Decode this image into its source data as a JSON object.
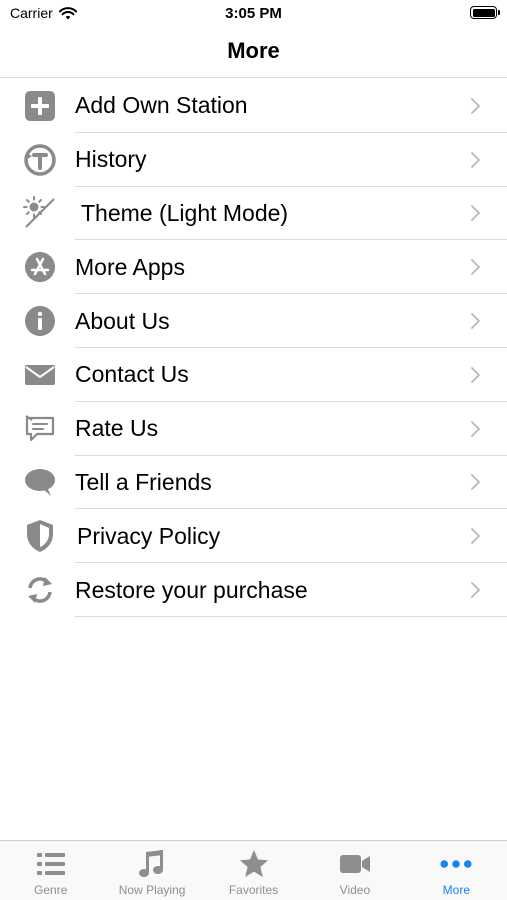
{
  "status_bar": {
    "carrier": "Carrier",
    "time": "3:05 PM"
  },
  "nav": {
    "title": "More"
  },
  "menu": [
    {
      "label": "Add Own Station",
      "icon": "plus-square-icon"
    },
    {
      "label": "History",
      "icon": "history-icon"
    },
    {
      "label": "Theme (Light Mode)",
      "icon": "theme-sun-moon-icon"
    },
    {
      "label": "More Apps",
      "icon": "app-store-icon"
    },
    {
      "label": "About Us",
      "icon": "info-icon"
    },
    {
      "label": "Contact Us",
      "icon": "envelope-icon"
    },
    {
      "label": "Rate Us",
      "icon": "rate-icon"
    },
    {
      "label": "Tell a Friends",
      "icon": "speech-bubble-icon"
    },
    {
      "label": "Privacy Policy",
      "icon": "shield-icon"
    },
    {
      "label": "Restore your purchase",
      "icon": "restore-arrows-icon"
    }
  ],
  "tabs": [
    {
      "label": "Genre",
      "icon": "list-icon",
      "active": false
    },
    {
      "label": "Now Playing",
      "icon": "music-note-icon",
      "active": false
    },
    {
      "label": "Favorites",
      "icon": "star-icon",
      "active": false
    },
    {
      "label": "Video",
      "icon": "video-camera-icon",
      "active": false
    },
    {
      "label": "More",
      "icon": "more-dots-icon",
      "active": true
    }
  ],
  "colors": {
    "icon_gray": "#8a8a8a",
    "active_blue": "#1a82f7",
    "inactive_tab": "#8e8e8e"
  }
}
